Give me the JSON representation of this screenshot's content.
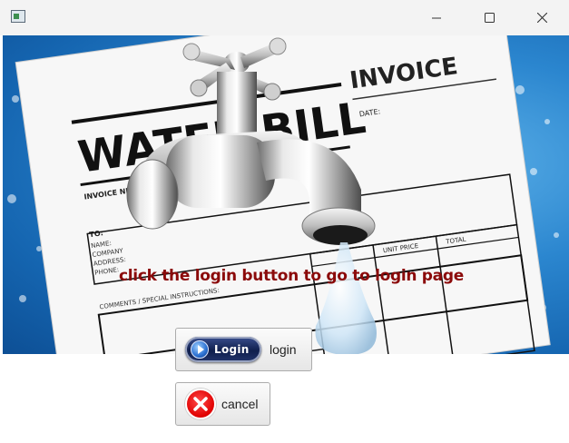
{
  "window": {
    "icons": {
      "app": "app-window-icon",
      "minimize": "minimize-icon",
      "maximize": "maximize-icon",
      "close": "close-icon"
    }
  },
  "hero": {
    "caption": "click the login button to go to login page",
    "bill": {
      "title": "WATER BILL",
      "invoice": "INVOICE",
      "date_label": "DATE:",
      "invoice_nr_label": "INVOICE NR.:",
      "to_label": "TO:",
      "name_label": "NAME:",
      "company_label": "COMPANY",
      "address_label": "ADDRESS:",
      "phone_label": "PHONE:",
      "special_label": "COMMENTS / SPECIAL INSTRUCTIONS:",
      "unit_price_label": "UNIT PRICE",
      "total_label": "TOTAL"
    }
  },
  "buttons": {
    "login": {
      "label": "login",
      "graphic_text": "Login",
      "icon": "login-play-icon"
    },
    "cancel": {
      "label": "cancel",
      "icon": "red-x-cancel-icon"
    }
  },
  "colors": {
    "caption": "#8b0a0a",
    "water": "#2b86cf",
    "cancel_icon": "#e00000"
  }
}
